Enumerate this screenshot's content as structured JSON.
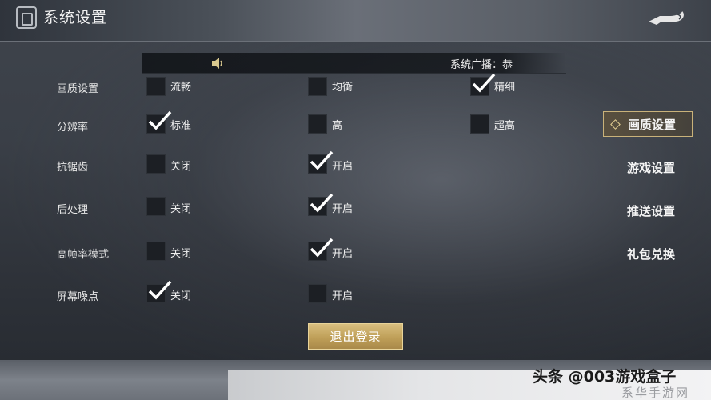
{
  "header": {
    "title": "系统设置",
    "back_icon": "back-arrow-icon",
    "logo_icon": "app-logo-icon"
  },
  "broadcast": {
    "text": "系统广播：恭",
    "speaker_icon": "speaker-icon"
  },
  "settings": [
    {
      "label": "画质设置",
      "options": [
        {
          "text": "流畅",
          "checked": false
        },
        {
          "text": "均衡",
          "checked": false
        },
        {
          "text": "精细",
          "checked": true
        }
      ]
    },
    {
      "label": "分辨率",
      "options": [
        {
          "text": "标准",
          "checked": true
        },
        {
          "text": "高",
          "checked": false
        },
        {
          "text": "超高",
          "checked": false
        }
      ]
    },
    {
      "label": "抗锯齿",
      "options": [
        {
          "text": "关闭",
          "checked": false
        },
        {
          "text": "开启",
          "checked": true
        }
      ]
    },
    {
      "label": "后处理",
      "options": [
        {
          "text": "关闭",
          "checked": false
        },
        {
          "text": "开启",
          "checked": true
        }
      ]
    },
    {
      "label": "高帧率模式",
      "options": [
        {
          "text": "关闭",
          "checked": false
        },
        {
          "text": "开启",
          "checked": true
        }
      ]
    },
    {
      "label": "屏幕噪点",
      "options": [
        {
          "text": "关闭",
          "checked": true
        },
        {
          "text": "开启",
          "checked": false
        }
      ]
    }
  ],
  "logout_button": "退出登录",
  "side_tabs": [
    {
      "label": "画质设置",
      "active": true
    },
    {
      "label": "游戏设置",
      "active": false
    },
    {
      "label": "推送设置",
      "active": false
    },
    {
      "label": "礼包兑换",
      "active": false
    }
  ],
  "watermark": {
    "primary": "头条 @003游戏盒子",
    "secondary": "系华手游网"
  },
  "colors": {
    "accent_gold": "#c9b27a",
    "button_gold": "#bf9f58",
    "checkbox_bg": "#1c1f24"
  }
}
